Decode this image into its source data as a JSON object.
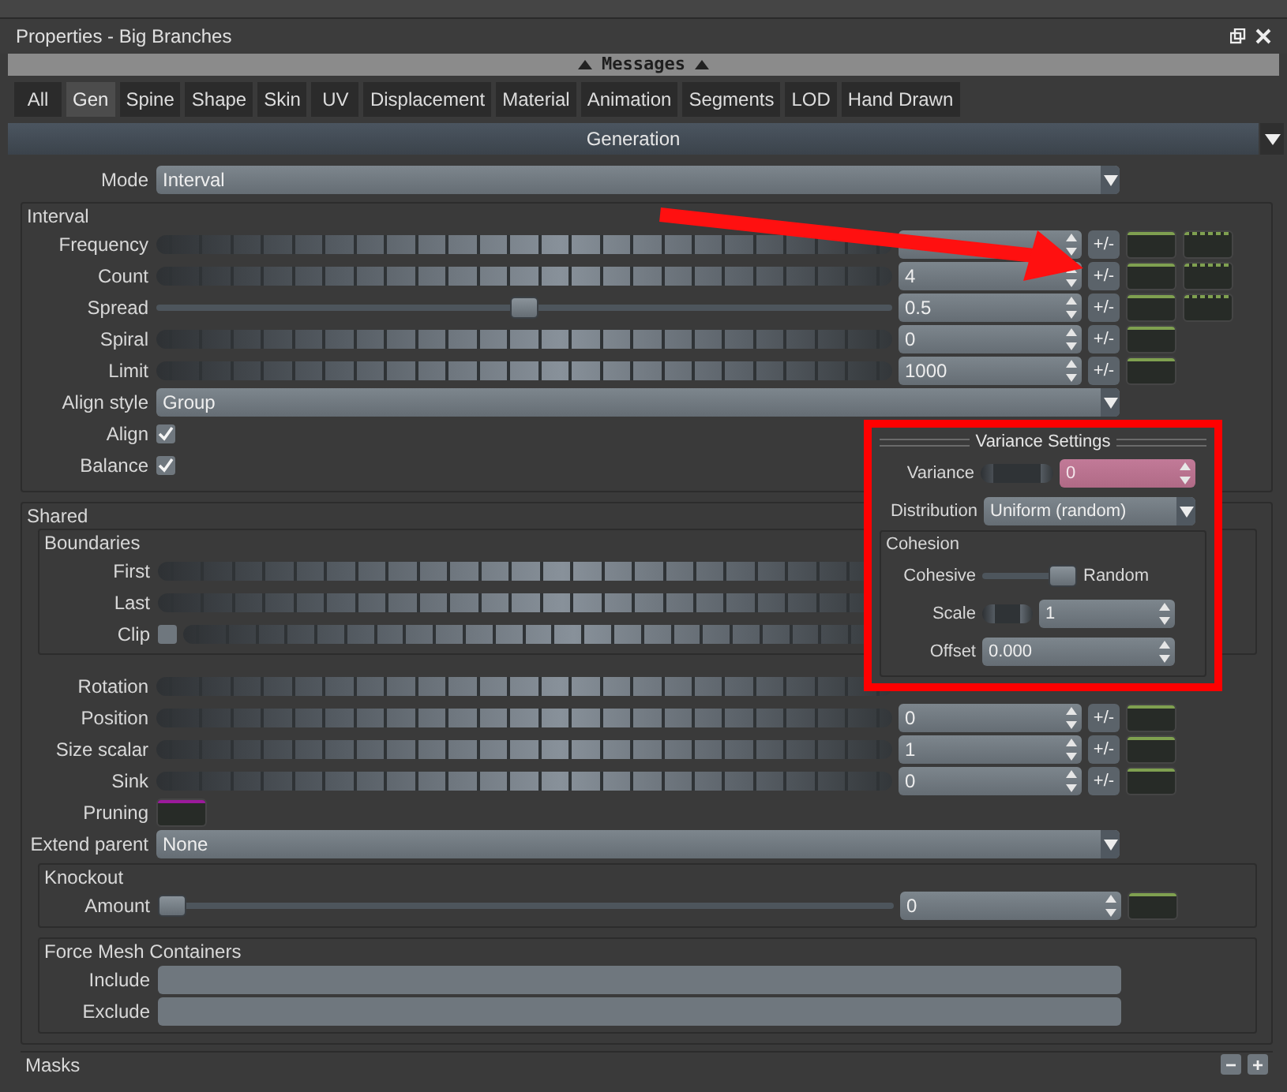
{
  "window": {
    "title": "Properties - Big Branches"
  },
  "messages_bar": {
    "label": "Messages"
  },
  "tabs": [
    {
      "label": "All",
      "selected": false
    },
    {
      "label": "Gen",
      "selected": true
    },
    {
      "label": "Spine",
      "selected": false
    },
    {
      "label": "Shape",
      "selected": false
    },
    {
      "label": "Skin",
      "selected": false
    },
    {
      "label": "UV",
      "selected": false
    },
    {
      "label": "Displacement",
      "selected": false
    },
    {
      "label": "Material",
      "selected": false
    },
    {
      "label": "Animation",
      "selected": false
    },
    {
      "label": "Segments",
      "selected": false
    },
    {
      "label": "LOD",
      "selected": false
    },
    {
      "label": "Hand Drawn",
      "selected": false
    }
  ],
  "section": {
    "title": "Generation"
  },
  "mode": {
    "label": "Mode",
    "kind": "dropdown",
    "value": "Interval"
  },
  "interval": {
    "title": "Interval",
    "rows": [
      {
        "label": "Frequency",
        "kind": "ramp",
        "toggle": "+/-",
        "curves": [
          {
            "kind": "solid",
            "color": "#7fa050"
          },
          {
            "kind": "dashed",
            "color": "#7fa050"
          }
        ]
      },
      {
        "label": "Count",
        "kind": "ramp",
        "value": "4",
        "toggle": "+/-",
        "curves": [
          {
            "kind": "solid",
            "color": "#7fa050"
          },
          {
            "kind": "dashed",
            "color": "#7fa050"
          }
        ]
      },
      {
        "label": "Spread",
        "kind": "slider",
        "level": 0.5,
        "value": "0.5",
        "toggle": "+/-",
        "curves": [
          {
            "kind": "solid",
            "color": "#7fa050"
          },
          {
            "kind": "dashed",
            "color": "#7fa050"
          }
        ]
      },
      {
        "label": "Spiral",
        "kind": "ramp",
        "value": "0",
        "toggle": "+/-",
        "curves": [
          {
            "kind": "solid",
            "color": "#7fa050"
          }
        ]
      },
      {
        "label": "Limit",
        "kind": "ramp",
        "value": "1000",
        "toggle": "+/-",
        "curves": [
          {
            "kind": "solid",
            "color": "#7fa050"
          }
        ]
      },
      {
        "label": "Align style",
        "kind": "dropdown",
        "value": "Group"
      },
      {
        "label": "Align",
        "kind": "checkbox",
        "checked": true
      },
      {
        "label": "Balance",
        "kind": "checkbox",
        "checked": true
      }
    ]
  },
  "shared": {
    "title": "Shared",
    "boundaries": {
      "title": "Boundaries",
      "rows": [
        {
          "label": "First",
          "kind": "ramp"
        },
        {
          "label": "Last",
          "kind": "ramp"
        },
        {
          "label": "Clip",
          "kind": "check_ramp",
          "checked": false
        }
      ]
    },
    "rows": [
      {
        "label": "Rotation",
        "kind": "ramp"
      },
      {
        "label": "Position",
        "kind": "ramp",
        "value": "0",
        "toggle": "+/-",
        "curves": [
          {
            "kind": "solid",
            "color": "#7fa050"
          }
        ]
      },
      {
        "label": "Size scalar",
        "kind": "ramp",
        "value": "1",
        "toggle": "+/-",
        "curves": [
          {
            "kind": "solid",
            "color": "#7fa050"
          }
        ]
      },
      {
        "label": "Sink",
        "kind": "ramp",
        "value": "0",
        "toggle": "+/-",
        "curves": [
          {
            "kind": "solid",
            "color": "#7fa050"
          }
        ]
      },
      {
        "label": "Pruning",
        "kind": "swatch",
        "curves": [
          {
            "kind": "solid",
            "color": "#9b1a9b"
          }
        ]
      },
      {
        "label": "Extend parent",
        "kind": "dropdown",
        "value": "None"
      }
    ],
    "knockout": {
      "title": "Knockout",
      "rows": [
        {
          "label": "Amount",
          "kind": "slider",
          "level": 0,
          "value": "0",
          "curves": [
            {
              "kind": "solid",
              "color": "#7fa050"
            }
          ]
        }
      ]
    },
    "force_mesh_containers": {
      "title": "Force Mesh Containers",
      "rows": [
        {
          "label": "Include",
          "kind": "field"
        },
        {
          "label": "Exclude",
          "kind": "field"
        }
      ]
    }
  },
  "masks": {
    "title": "Masks",
    "buttons": [
      "−",
      "+"
    ]
  },
  "variance_popup": {
    "title": "Variance Settings",
    "variance": {
      "label": "Variance",
      "value": "0",
      "highlighted": true
    },
    "distribution": {
      "label": "Distribution",
      "value": "Uniform (random)"
    },
    "cohesion": {
      "title": "Cohesion",
      "cohesive": {
        "label": "Cohesive",
        "level": 1,
        "end_label": "Random"
      },
      "scale": {
        "label": "Scale",
        "value": "1"
      },
      "offset": {
        "label": "Offset",
        "value": "0.000"
      }
    }
  }
}
